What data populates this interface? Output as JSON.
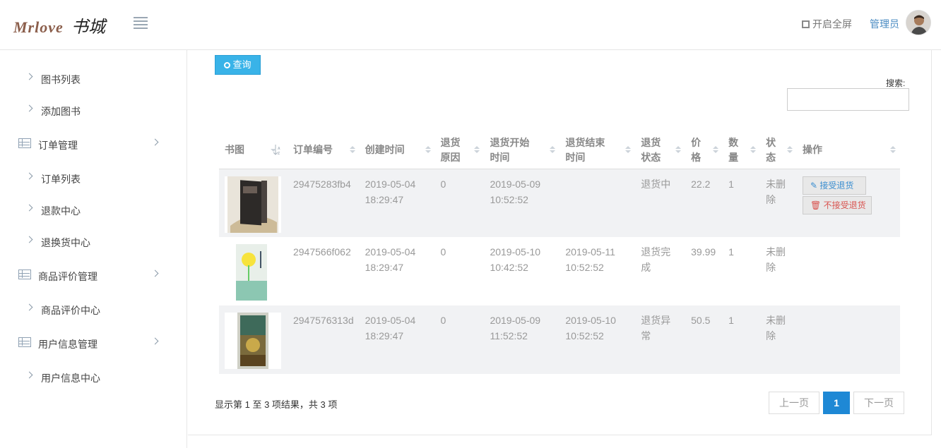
{
  "header": {
    "logo_en": "Mrlove",
    "logo_cn": "书城",
    "fullscreen_label": "开启全屏",
    "admin_label": "管理员"
  },
  "sidebar": {
    "items": [
      {
        "type": "sub",
        "label": "图书列表"
      },
      {
        "type": "sub",
        "label": "添加图书"
      },
      {
        "type": "group",
        "label": "订单管理"
      },
      {
        "type": "sub",
        "label": "订单列表"
      },
      {
        "type": "sub",
        "label": "退款中心"
      },
      {
        "type": "sub",
        "label": "退换货中心"
      },
      {
        "type": "group",
        "label": "商品评价管理"
      },
      {
        "type": "sub",
        "label": "商品评价中心"
      },
      {
        "type": "group",
        "label": "用户信息管理"
      },
      {
        "type": "sub",
        "label": "用户信息中心"
      }
    ]
  },
  "toolbar": {
    "query_label": "查询",
    "search_label": "搜索:",
    "search_value": ""
  },
  "table": {
    "columns": [
      [
        "书图"
      ],
      [
        "订单编号"
      ],
      [
        "创建时间"
      ],
      [
        "退货",
        "原因"
      ],
      [
        "退货开始",
        "时间"
      ],
      [
        "退货结束",
        "时间"
      ],
      [
        "退货",
        "状态"
      ],
      [
        "价",
        "格"
      ],
      [
        "数",
        "量"
      ],
      [
        "状",
        "态"
      ],
      [
        "操作"
      ]
    ],
    "rows": [
      {
        "order_no": "29475283fb4",
        "created": [
          "2019-05-04",
          "18:29:47"
        ],
        "reason": "0",
        "start": [
          "2019-05-09",
          "10:52:52"
        ],
        "end": [
          "",
          ""
        ],
        "return_status": [
          "退货中"
        ],
        "price": "22.2",
        "qty": "1",
        "status": [
          "未删",
          "除"
        ],
        "actions": [
          "接受退货",
          "不接受退货"
        ],
        "cover": "dark-book-cover"
      },
      {
        "order_no": "2947566f062",
        "created": [
          "2019-05-04",
          "18:29:47"
        ],
        "reason": "0",
        "start": [
          "2019-05-10",
          "10:42:52"
        ],
        "end": [
          "2019-05-11",
          "10:52:52"
        ],
        "return_status": [
          "退货完",
          "成"
        ],
        "price": "39.99",
        "qty": "1",
        "status": [
          "未删",
          "除"
        ],
        "actions": [],
        "cover": "mint-book-cover"
      },
      {
        "order_no": "2947576313d",
        "created": [
          "2019-05-04",
          "18:29:47"
        ],
        "reason": "0",
        "start": [
          "2019-05-09",
          "11:52:52"
        ],
        "end": [
          "2019-05-10",
          "10:52:52"
        ],
        "return_status": [
          "退货异",
          "常"
        ],
        "price": "50.5",
        "qty": "1",
        "status": [
          "未删",
          "除"
        ],
        "actions": [],
        "cover": "brown-book-cover"
      }
    ]
  },
  "footer": {
    "info": "显示第 1 至 3 项结果，共 3 项",
    "prev": "上一页",
    "page": "1",
    "next": "下一页"
  }
}
